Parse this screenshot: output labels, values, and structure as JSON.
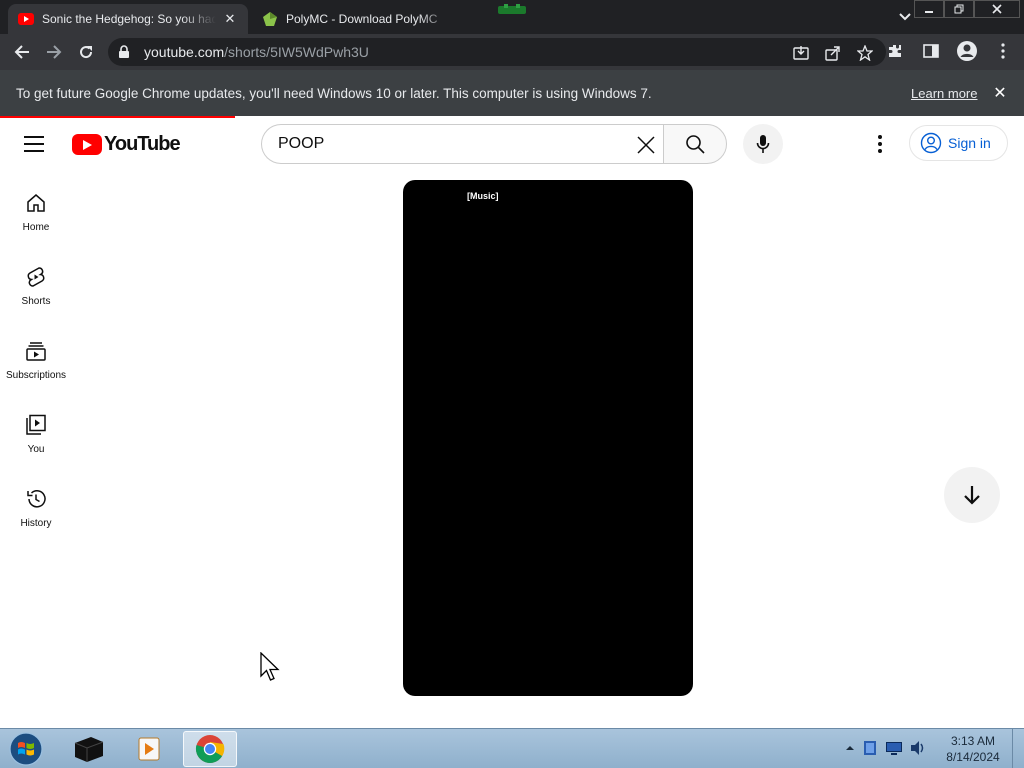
{
  "browser": {
    "tabs": [
      {
        "title": "Sonic the Hedgehog: So you had",
        "icon": "youtube-icon",
        "active": true
      },
      {
        "title": "PolyMC - Download PolyMC",
        "icon": "polymc-icon",
        "active": false
      }
    ],
    "url": {
      "host": "youtube.com",
      "path": "/shorts/5IW5WdPwh3U"
    },
    "infobar": {
      "message": "To get future Google Chrome updates, you'll need Windows 10 or later. This computer is using Windows 7.",
      "link": "Learn more"
    }
  },
  "youtube": {
    "logo_text": "YouTube",
    "search": {
      "value": "POOP"
    },
    "sign_in": "Sign in",
    "sidebar": [
      {
        "label": "Home",
        "icon": "home-icon"
      },
      {
        "label": "Shorts",
        "icon": "shorts-icon"
      },
      {
        "label": "Subscriptions",
        "icon": "subscriptions-icon"
      },
      {
        "label": "You",
        "icon": "you-icon"
      },
      {
        "label": "History",
        "icon": "history-icon"
      }
    ],
    "player": {
      "caption": "[Music]"
    }
  },
  "taskbar": {
    "time": "3:13 AM",
    "date": "8/14/2024"
  },
  "colors": {
    "youtube_red": "#ff0000",
    "signin_blue": "#065fd4",
    "chrome_dark": "#202124"
  }
}
